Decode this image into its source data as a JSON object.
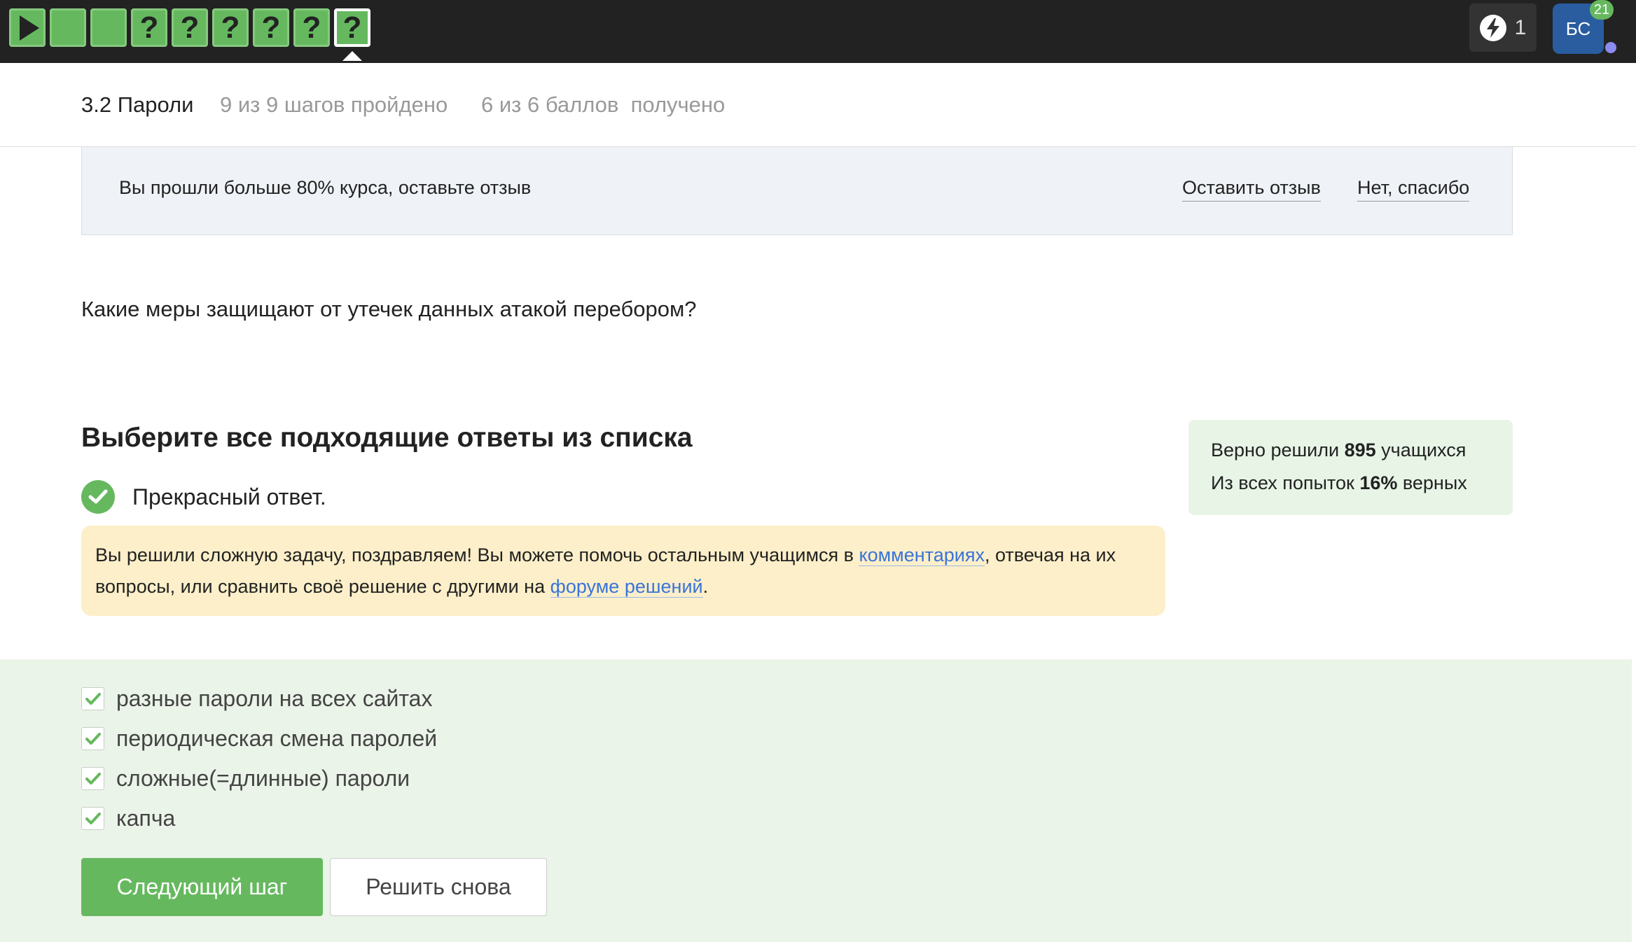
{
  "topbar": {
    "steps": [
      {
        "type": "video",
        "icon": "play-icon",
        "label": ""
      },
      {
        "type": "text",
        "label": ""
      },
      {
        "type": "text",
        "label": ""
      },
      {
        "type": "quiz",
        "label": "?"
      },
      {
        "type": "quiz",
        "label": "?"
      },
      {
        "type": "quiz",
        "label": "?"
      },
      {
        "type": "quiz",
        "label": "?"
      },
      {
        "type": "quiz",
        "label": "?"
      },
      {
        "type": "quiz",
        "label": "?",
        "active": true
      }
    ],
    "energy": {
      "icon": "lightning-icon",
      "count": "1"
    },
    "avatar": {
      "initials": "БС",
      "badge": "21"
    }
  },
  "lesson": {
    "title": "3.2 Пароли",
    "steps_progress": "9 из 9 шагов пройдено",
    "points_progress": "6 из 6 баллов  получено"
  },
  "review_banner": {
    "text": "Вы прошли больше 80% курса, оставьте отзыв",
    "leave_review": "Оставить отзыв",
    "no_thanks": "Нет, спасибо"
  },
  "question": "Какие меры защищают от утечек данных атакой перебором?",
  "choose_title": "Выберите все подходящие ответы из списка",
  "result": {
    "icon": "check-circle-icon",
    "text": "Прекрасный ответ."
  },
  "hint": {
    "part1": "Вы решили сложную задачу, поздравляем! Вы можете помочь остальным учащимся в ",
    "comments_link": "комментариях",
    "part2": ", отвечая на их вопросы, или сравнить своё решение с другими на ",
    "forum_link": "форуме решений",
    "part3": "."
  },
  "stats": {
    "line1_prefix": "Верно решили ",
    "solved_count": "895",
    "line1_suffix": " учащихся",
    "line2_prefix": "Из всех попыток ",
    "correct_percent": "16%",
    "line2_suffix": " верных"
  },
  "options": [
    {
      "label": "разные пароли на всех сайтах",
      "checked": true
    },
    {
      "label": "периодическая смена паролей",
      "checked": true
    },
    {
      "label": "сложные(=длинные) пароли",
      "checked": true
    },
    {
      "label": "капча",
      "checked": true
    }
  ],
  "buttons": {
    "next": "Следующий шаг",
    "retry": "Решить снова"
  },
  "colors": {
    "accent_green": "#66b85f",
    "topbar_bg": "#222222",
    "link_blue": "#3a74d9",
    "hint_bg": "#fcefc9",
    "answers_bg": "#eaf4e8"
  }
}
